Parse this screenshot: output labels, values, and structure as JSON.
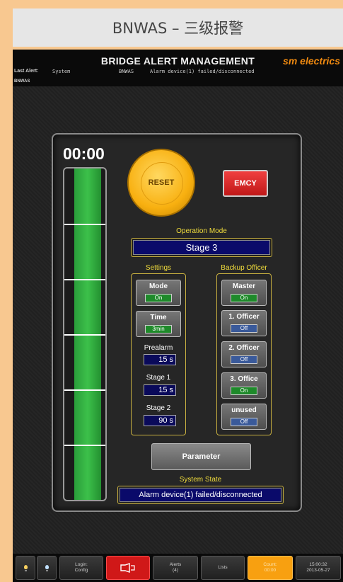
{
  "caption": "BNWAS – 三级报警",
  "header": {
    "title": "BRIDGE ALERT MANAGEMENT",
    "brand": "sm electrics",
    "last_alert_label": "Last Alert:",
    "alert_source": "System",
    "alert_module": "BNWAS",
    "alert_message": "Alarm device(1) failed/disconnected",
    "module_tag": "BNWAS"
  },
  "panel": {
    "timer": "00:00",
    "bargraph_fill_fraction": 1.0,
    "reset_label": "RESET",
    "emcy_label": "EMCY",
    "operation_mode_label": "Operation Mode",
    "operation_mode_value": "Stage 3",
    "settings_label": "Settings",
    "backup_officer_label": "Backup Officer",
    "settings_buttons": [
      {
        "label": "Mode",
        "state": "On"
      },
      {
        "label": "Time",
        "state": "3min"
      }
    ],
    "params": [
      {
        "label": "Prealarm",
        "value": "15 s"
      },
      {
        "label": "Stage 1",
        "value": "15 s"
      },
      {
        "label": "Stage 2",
        "value": "90 s"
      }
    ],
    "backup_buttons": [
      {
        "label": "Master",
        "state": "On"
      },
      {
        "label": "1. Officer",
        "state": "Off"
      },
      {
        "label": "2. Officer",
        "state": "Off"
      },
      {
        "label": "3. Office",
        "state": "On"
      },
      {
        "label": "unused",
        "state": "Off"
      }
    ],
    "parameter_label": "Parameter",
    "system_state_label": "System State",
    "system_state_value": "Alarm device(1) failed/disconnected"
  },
  "taskbar": {
    "login_line1": "Login:",
    "login_line2": "Config",
    "alerts_line1": "Alerts",
    "alerts_line2": "(4)",
    "lists_label": "Lists",
    "count_line1": "Count:",
    "count_line2": "00:00",
    "time": "15:00:32",
    "date": "2013-05-27"
  },
  "colors": {
    "accent_yellow": "#f0dc3c",
    "brand_orange": "#f08a10",
    "on_green": "#1e8a2a",
    "alarm_red": "#d01818"
  }
}
